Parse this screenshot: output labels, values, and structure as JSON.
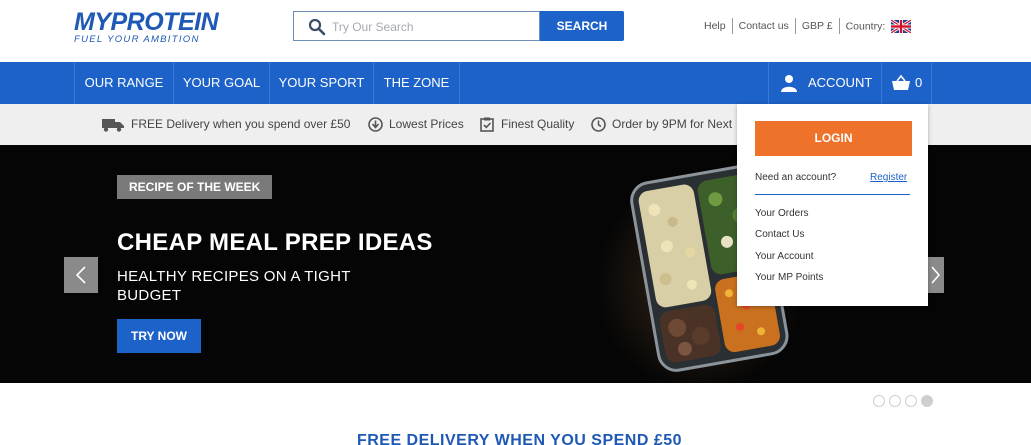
{
  "header": {
    "logo": {
      "name": "MYPROTEIN",
      "tagline": "FUEL YOUR AMBITION"
    },
    "search": {
      "placeholder": "Try Our Search",
      "button_label": "SEARCH"
    },
    "links": {
      "help": "Help",
      "contact": "Contact us",
      "currency": "GBP £",
      "country": "Country:"
    }
  },
  "nav": {
    "items": [
      {
        "label": "OUR RANGE"
      },
      {
        "label": "YOUR GOAL"
      },
      {
        "label": "YOUR SPORT"
      },
      {
        "label": "THE ZONE"
      }
    ],
    "account_label": "ACCOUNT",
    "basket_count": "0"
  },
  "usp": {
    "items": [
      {
        "icon": "delivery-truck-icon",
        "label": "FREE Delivery when you spend over £50"
      },
      {
        "icon": "down-arrow-circle-icon",
        "label": "Lowest Prices"
      },
      {
        "icon": "clipboard-check-icon",
        "label": "Finest Quality"
      },
      {
        "icon": "clock-icon",
        "label": "Order by 9PM for Next"
      }
    ]
  },
  "hero": {
    "tag": "RECIPE OF THE WEEK",
    "title": "CHEAP MEAL PREP IDEAS",
    "subtitle": "HEALTHY RECIPES ON A TIGHT BUDGET",
    "cta": "TRY NOW"
  },
  "account_dropdown": {
    "login_label": "LOGIN",
    "need_account": "Need an account?",
    "register": "Register",
    "links": [
      "Your Orders",
      "Contact Us",
      "Your Account",
      "Your MP Points"
    ]
  },
  "carousel": {
    "slide_count": 4,
    "active_index": 3
  },
  "promo_banner": "FREE DELIVERY WHEN YOU SPEND £50",
  "colors": {
    "brand_blue": "#1d62c8",
    "login_orange": "#ee7229",
    "hero_bg": "#050505"
  }
}
